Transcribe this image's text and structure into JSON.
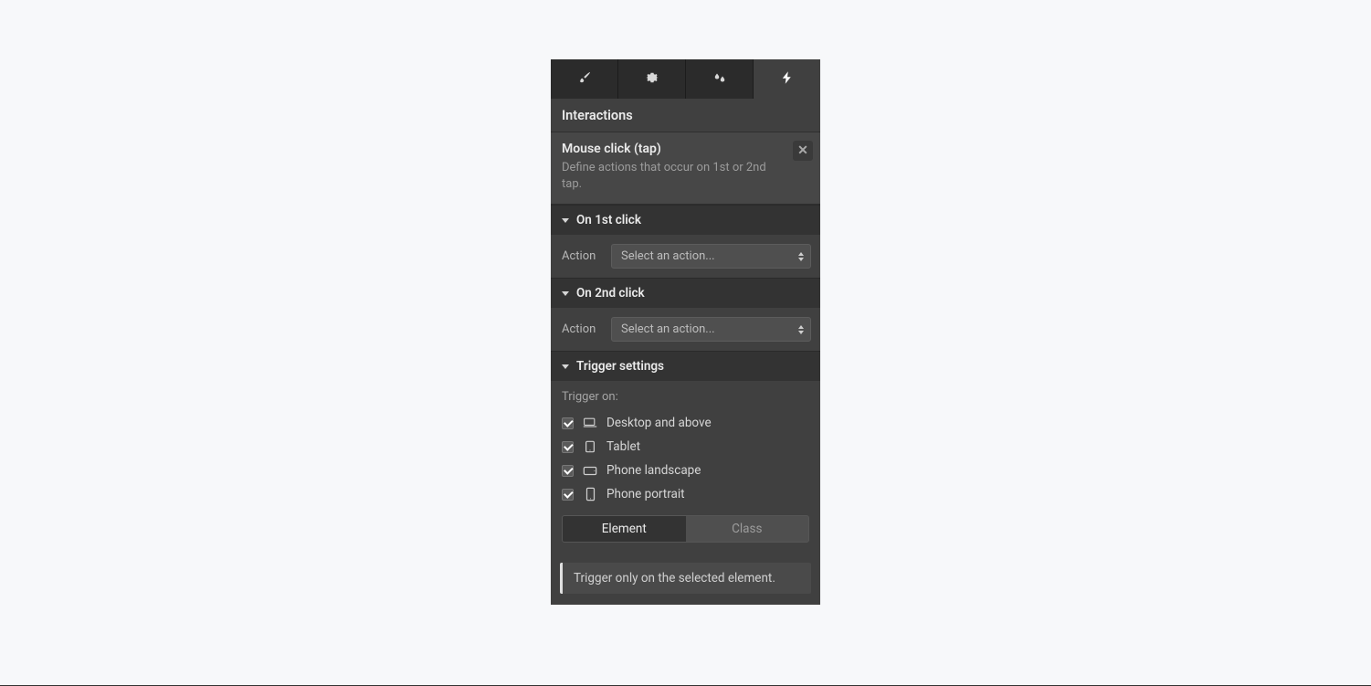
{
  "panel": {
    "title": "Interactions"
  },
  "trigger": {
    "title": "Mouse click (tap)",
    "description": "Define actions that occur on 1st or 2nd tap."
  },
  "sections": {
    "first_click": {
      "header": "On 1st click",
      "action_label": "Action",
      "select_placeholder": "Select an action..."
    },
    "second_click": {
      "header": "On 2nd click",
      "action_label": "Action",
      "select_placeholder": "Select an action..."
    },
    "settings": {
      "header": "Trigger settings",
      "trigger_on_label": "Trigger on:",
      "breakpoints": [
        {
          "label": "Desktop and above",
          "checked": true
        },
        {
          "label": "Tablet",
          "checked": true
        },
        {
          "label": "Phone landscape",
          "checked": true
        },
        {
          "label": "Phone portrait",
          "checked": true
        }
      ],
      "toggle": {
        "element": "Element",
        "class": "Class",
        "active": "element"
      },
      "info": "Trigger only on the selected element."
    }
  }
}
